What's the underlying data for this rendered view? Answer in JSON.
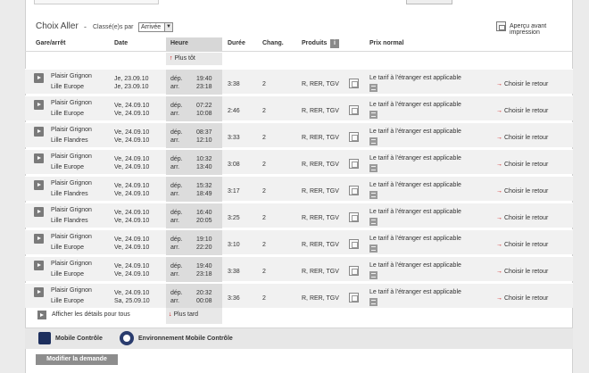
{
  "section": {
    "title": "Choix Aller",
    "title_sep": "-",
    "sort_label": "Classé(e)s par",
    "sort_value": "Arrivée",
    "print_label": "Aperçu avant impression"
  },
  "columns": {
    "station": "Gare/arrêt",
    "date": "Date",
    "time": "Heure",
    "duration": "Durée",
    "changes": "Chang.",
    "products": "Produits",
    "price": "Prix normal"
  },
  "earlier_label": "Plus tôt",
  "later_label": "Plus tard",
  "details_label": "Afficher les détails pour tous",
  "dep_label": "dép.",
  "arr_label": "arr.",
  "return_label": "Choisir le retour",
  "tarif_text": "Le tarif à l'étranger est applicable",
  "connections": [
    {
      "from": "Plaisir Grignon",
      "to": "Lille Europe",
      "date_dep": "Je, 23.09.10",
      "date_arr": "Je, 23.09.10",
      "dep": "19:40",
      "arr": "23:18",
      "duration": "3:38",
      "changes": "2",
      "products": "R, RER, TGV"
    },
    {
      "from": "Plaisir Grignon",
      "to": "Lille Europe",
      "date_dep": "Ve, 24.09.10",
      "date_arr": "Ve, 24.09.10",
      "dep": "07:22",
      "arr": "10:08",
      "duration": "2:46",
      "changes": "2",
      "products": "R, RER, TGV"
    },
    {
      "from": "Plaisir Grignon",
      "to": "Lille Flandres",
      "date_dep": "Ve, 24.09.10",
      "date_arr": "Ve, 24.09.10",
      "dep": "08:37",
      "arr": "12:10",
      "duration": "3:33",
      "changes": "2",
      "products": "R, RER, TGV"
    },
    {
      "from": "Plaisir Grignon",
      "to": "Lille Europe",
      "date_dep": "Ve, 24.09.10",
      "date_arr": "Ve, 24.09.10",
      "dep": "10:32",
      "arr": "13:40",
      "duration": "3:08",
      "changes": "2",
      "products": "R, RER, TGV"
    },
    {
      "from": "Plaisir Grignon",
      "to": "Lille Flandres",
      "date_dep": "Ve, 24.09.10",
      "date_arr": "Ve, 24.09.10",
      "dep": "15:32",
      "arr": "18:49",
      "duration": "3:17",
      "changes": "2",
      "products": "R, RER, TGV"
    },
    {
      "from": "Plaisir Grignon",
      "to": "Lille Flandres",
      "date_dep": "Ve, 24.09.10",
      "date_arr": "Ve, 24.09.10",
      "dep": "16:40",
      "arr": "20:05",
      "duration": "3:25",
      "changes": "2",
      "products": "R, RER, TGV"
    },
    {
      "from": "Plaisir Grignon",
      "to": "Lille Europe",
      "date_dep": "Ve, 24.09.10",
      "date_arr": "Ve, 24.09.10",
      "dep": "19:10",
      "arr": "22:20",
      "duration": "3:10",
      "changes": "2",
      "products": "R, RER, TGV"
    },
    {
      "from": "Plaisir Grignon",
      "to": "Lille Europe",
      "date_dep": "Ve, 24.09.10",
      "date_arr": "Ve, 24.09.10",
      "dep": "19:40",
      "arr": "23:18",
      "duration": "3:38",
      "changes": "2",
      "products": "R, RER, TGV"
    },
    {
      "from": "Plaisir Grignon",
      "to": "Lille Europe",
      "date_dep": "Ve, 24.09.10",
      "date_arr": "Sa, 25.09.10",
      "dep": "20:32",
      "arr": "00:08",
      "duration": "3:36",
      "changes": "2",
      "products": "R, RER, TGV"
    }
  ],
  "mobile": {
    "control_label": "Mobile Contrôle",
    "env_label": "Environnement Mobile Contrôle"
  },
  "modify_button": "Modifier la demande"
}
